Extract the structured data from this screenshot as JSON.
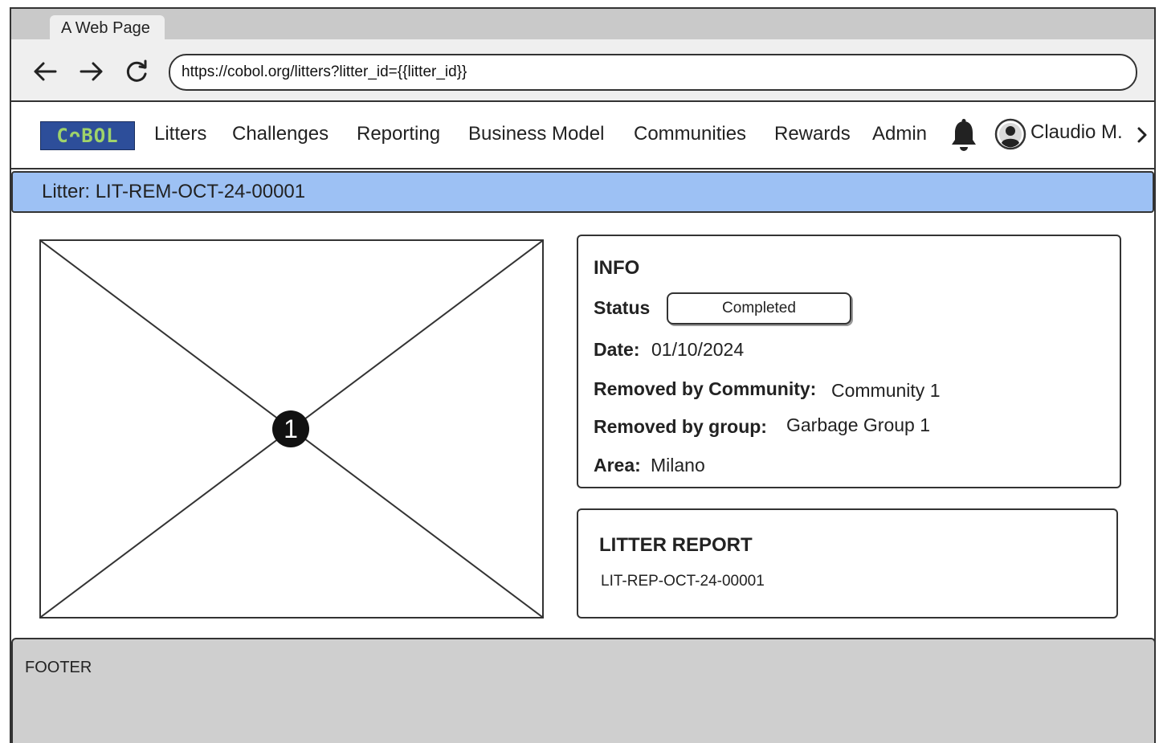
{
  "browser": {
    "tab_title": "A Web Page",
    "url": "https://cobol.org/litters?litter_id={{litter_id}}"
  },
  "nav": {
    "logo_text": "CᴖBOL",
    "items": [
      "Litters",
      "Challenges",
      "Reporting",
      "Business Model",
      "Communities",
      "Rewards",
      "Admin"
    ],
    "user_name": "Claudio M."
  },
  "page": {
    "title": "Litter: LIT-REM-OCT-24-00001"
  },
  "image_badge": "1",
  "info": {
    "heading": "INFO",
    "status_label": "Status",
    "status_value": "Completed",
    "date_label": "Date:",
    "date_value": "01/10/2024",
    "community_label": "Removed by Community:",
    "community_value": "Community 1",
    "group_label": "Removed by group:",
    "group_value": "Garbage Group 1",
    "area_label": "Area:",
    "area_value": "Milano"
  },
  "report": {
    "heading": "LITTER REPORT",
    "code": "LIT-REP-OCT-24-00001"
  },
  "footer": {
    "label": "FOOTER"
  },
  "colors": {
    "title_bar": "#9dc1f4",
    "logo_bg": "#2d4e9a",
    "logo_text": "#9fd36a",
    "footer_bg": "#cfcfcf"
  }
}
